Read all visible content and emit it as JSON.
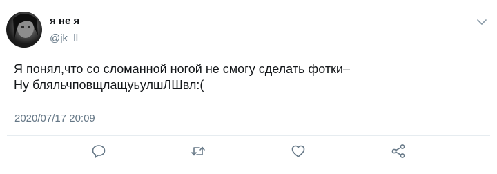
{
  "user": {
    "display_name": "я не я",
    "handle": "@jk_ll"
  },
  "tweet": {
    "text": "Я понял,что со сломанной ногой не смогу сделать фотки–\nНу бляльчповщлащуьулшЛШвл:(",
    "timestamp": "2020/07/17 20:09"
  },
  "icons": {
    "caret": "chevron-down-icon",
    "reply": "reply-icon",
    "retweet": "retweet-icon",
    "like": "heart-icon",
    "share": "share-icon"
  },
  "colors": {
    "text_primary": "#14171a",
    "text_secondary": "#657786",
    "icon_gray": "#657786",
    "divider": "#e6ecf0"
  }
}
